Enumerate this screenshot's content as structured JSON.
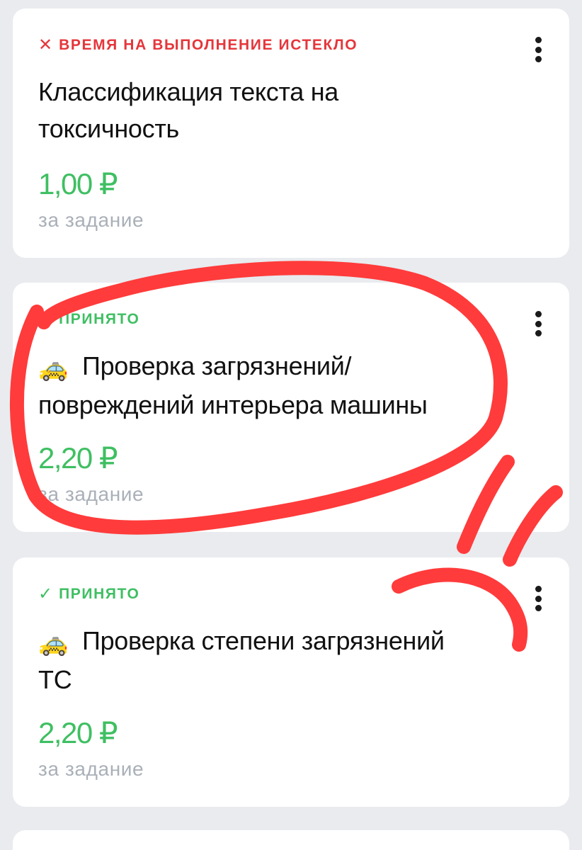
{
  "tasks": [
    {
      "status_glyph": "✕",
      "status": "ВРЕМЯ НА ВЫПОЛНЕНИЕ ИСТЕКЛО",
      "title_lines": [
        "Классификация текста на",
        "токсичность"
      ],
      "price": "1,00 ₽",
      "per_task": "за задание"
    },
    {
      "status_glyph": "✓",
      "status": "ПРИНЯТО",
      "emoji": "🚕",
      "title_lines": [
        "Проверка загрязнений/",
        "повреждений интерьера машины"
      ],
      "price": "2,20 ₽",
      "per_task": "за задание"
    },
    {
      "status_glyph": "✓",
      "status": "ПРИНЯТО",
      "emoji": "🚕",
      "title_lines": [
        "Проверка степени загрязнений",
        "ТС"
      ],
      "price": "2,20 ₽",
      "per_task": "за задание"
    }
  ],
  "colors": {
    "background": "#e9ebef",
    "card": "#ffffff",
    "expired_status": "#e5363b",
    "accepted_status": "#3fbf62",
    "price": "#3fbf62",
    "secondary_text": "#aab0b8",
    "annotation_marker": "#ff3b3b"
  },
  "icons": {
    "expired": "close-icon",
    "accepted": "check-icon",
    "menu": "more-vertical-icon",
    "task_emoji": "taxi-icon"
  }
}
